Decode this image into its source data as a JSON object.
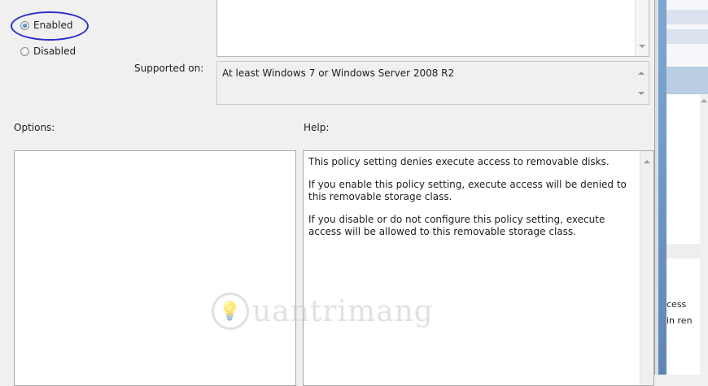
{
  "state": {
    "enabled_label": "Enabled",
    "disabled_label": "Disabled",
    "selected": "Enabled"
  },
  "supported": {
    "label": "Supported on:",
    "value": "At least Windows 7 or Windows Server 2008 R2"
  },
  "options": {
    "label": "Options:"
  },
  "help": {
    "label": "Help:",
    "paragraphs": [
      "This policy setting denies execute access to removable disks.",
      "If you enable this policy setting, execute access will be denied to this removable storage class.",
      "If you disable or do not configure this policy setting, execute access will be allowed to this removable storage class."
    ]
  },
  "background_window": {
    "fragment_line_1": "cess",
    "fragment_line_2": "in ren"
  },
  "watermark": {
    "text": "uantrimang",
    "logo_glyph": "💡"
  },
  "colors": {
    "dialog_bg": "#f0f0f0",
    "highlight_ellipse": "#2b2fd1",
    "window_frame_blue": "#6f9ec9"
  }
}
